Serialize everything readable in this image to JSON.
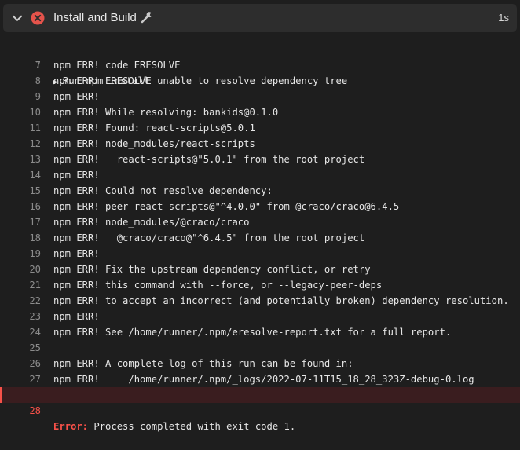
{
  "step": {
    "title": "Install and Build",
    "duration": "1s",
    "status": "failed",
    "status_color": "#e5534b"
  },
  "log": {
    "group": {
      "number": "1",
      "disclosure": "▶",
      "text": "Run npm install"
    },
    "lines": [
      {
        "number": "7",
        "text": "npm ERR! code ERESOLVE"
      },
      {
        "number": "8",
        "text": "npm ERR! ERESOLVE unable to resolve dependency tree"
      },
      {
        "number": "9",
        "text": "npm ERR!"
      },
      {
        "number": "10",
        "text": "npm ERR! While resolving: bankids@0.1.0"
      },
      {
        "number": "11",
        "text": "npm ERR! Found: react-scripts@5.0.1"
      },
      {
        "number": "12",
        "text": "npm ERR! node_modules/react-scripts"
      },
      {
        "number": "13",
        "text": "npm ERR!   react-scripts@\"5.0.1\" from the root project"
      },
      {
        "number": "14",
        "text": "npm ERR!"
      },
      {
        "number": "15",
        "text": "npm ERR! Could not resolve dependency:"
      },
      {
        "number": "16",
        "text": "npm ERR! peer react-scripts@\"^4.0.0\" from @craco/craco@6.4.5"
      },
      {
        "number": "17",
        "text": "npm ERR! node_modules/@craco/craco"
      },
      {
        "number": "18",
        "text": "npm ERR!   @craco/craco@\"^6.4.5\" from the root project"
      },
      {
        "number": "19",
        "text": "npm ERR!"
      },
      {
        "number": "20",
        "text": "npm ERR! Fix the upstream dependency conflict, or retry"
      },
      {
        "number": "21",
        "text": "npm ERR! this command with --force, or --legacy-peer-deps"
      },
      {
        "number": "22",
        "text": "npm ERR! to accept an incorrect (and potentially broken) dependency resolution."
      },
      {
        "number": "23",
        "text": "npm ERR!"
      },
      {
        "number": "24",
        "text": "npm ERR! See /home/runner/.npm/eresolve-report.txt for a full report."
      },
      {
        "number": "25",
        "text": ""
      },
      {
        "number": "26",
        "text": "npm ERR! A complete log of this run can be found in:"
      },
      {
        "number": "27",
        "text": "npm ERR!     /home/runner/.npm/_logs/2022-07-11T15_18_28_323Z-debug-0.log"
      }
    ],
    "error_line": {
      "number": "28",
      "label": "Error:",
      "text": " Process completed with exit code 1.",
      "color": "#f85149"
    }
  }
}
